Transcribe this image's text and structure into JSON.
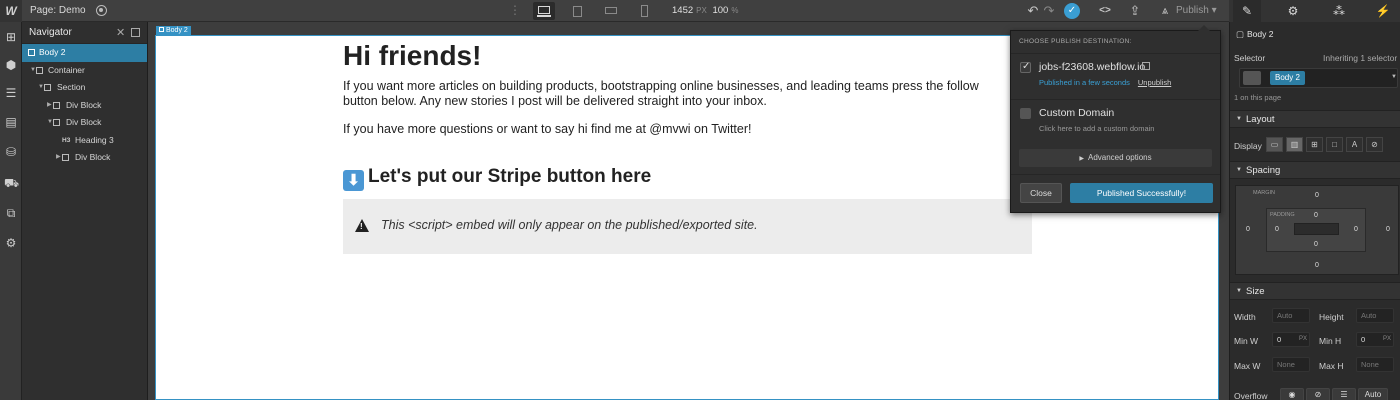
{
  "topbar": {
    "logo": "W",
    "page_label": "Page: Demo",
    "width_value": "1452",
    "width_unit": "PX",
    "zoom_value": "100",
    "zoom_unit": "%",
    "publish_label": "Publish",
    "publish_caret": "▾",
    "undo_icon": "↶",
    "redo_icon": "↷",
    "code_icon": "<>",
    "export_icon": "⇪",
    "accent_color": "#3592c4"
  },
  "navigator": {
    "title": "Navigator",
    "close_icon": "✕",
    "items": [
      {
        "label": "Body 2"
      },
      {
        "label": "Container"
      },
      {
        "label": "Section"
      },
      {
        "label": "Div Block"
      },
      {
        "label": "Div Block"
      },
      {
        "label": "Heading 3",
        "tag": "H3"
      },
      {
        "label": "Div Block"
      }
    ]
  },
  "canvas": {
    "badge": "Body 2",
    "heading": "Hi friends!",
    "para1_line1": "If you want more articles on building products, bootstrapping online businesses, and leading teams press the follow",
    "para1_line2": "button below. Any new stories I post will be delivered straight into your inbox.",
    "para2": "If you have more questions or want to say hi find me at @mvwi on Twitter!",
    "subheading": "Let's put our Stripe button here",
    "subheading_emoji": "⬇",
    "embed_notice": "This <script> embed will only appear on the published/exported site."
  },
  "publish_popover": {
    "title": "CHOOSE PUBLISH DESTINATION:",
    "destinations": [
      {
        "name": "jobs-f23608.webflow.io",
        "status": "Published in a few seconds",
        "action": "Unpublish",
        "checked": true
      },
      {
        "name": "Custom Domain",
        "hint": "Click here to add a custom domain",
        "checked": false
      }
    ],
    "advanced_label": "Advanced options",
    "close_label": "Close",
    "confirm_label": "Published Successfully!"
  },
  "style_panel": {
    "element_label": "Body 2",
    "selector_label": "Selector",
    "inheriting_label": "Inheriting 1 selector",
    "selector_tag": "Body 2",
    "on_page": "1 on this page",
    "layout": {
      "title": "Layout",
      "display_label": "Display",
      "display_options": [
        "▭",
        "▥",
        "⊞",
        "□",
        "A",
        "⊘"
      ]
    },
    "spacing": {
      "title": "Spacing",
      "margin_label": "MARGIN",
      "padding_label": "PADDING",
      "margin": {
        "top": "0",
        "right": "0",
        "bottom": "0",
        "left": "0"
      },
      "padding": {
        "top": "0",
        "right": "0",
        "bottom": "0",
        "left": "0"
      }
    },
    "size": {
      "title": "Size",
      "width_label": "Width",
      "width_value": "Auto",
      "height_label": "Height",
      "height_value": "Auto",
      "min_w_label": "Min W",
      "min_w_value": "0",
      "min_w_unit": "PX",
      "min_h_label": "Min H",
      "min_h_value": "0",
      "min_h_unit": "PX",
      "max_w_label": "Max W",
      "max_w_value": "None",
      "max_h_label": "Max H",
      "max_h_value": "None"
    },
    "overflow": {
      "label": "Overflow",
      "auto_label": "Auto"
    }
  }
}
